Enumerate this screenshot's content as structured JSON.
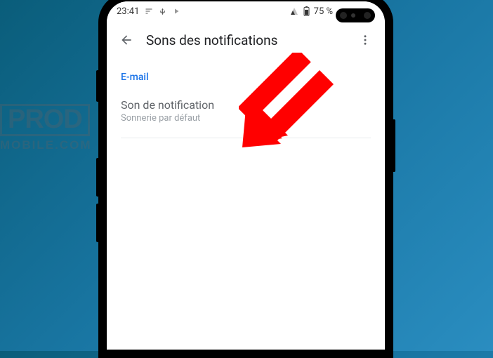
{
  "status": {
    "time": "23:41",
    "battery": "75 %"
  },
  "appbar": {
    "title": "Sons des notifications"
  },
  "section": {
    "label": "E-mail"
  },
  "setting": {
    "title": "Son de notification",
    "subtitle": "Sonnerie par défaut"
  },
  "watermark": {
    "main": "PROD",
    "sub": "MOBILE.COM"
  }
}
